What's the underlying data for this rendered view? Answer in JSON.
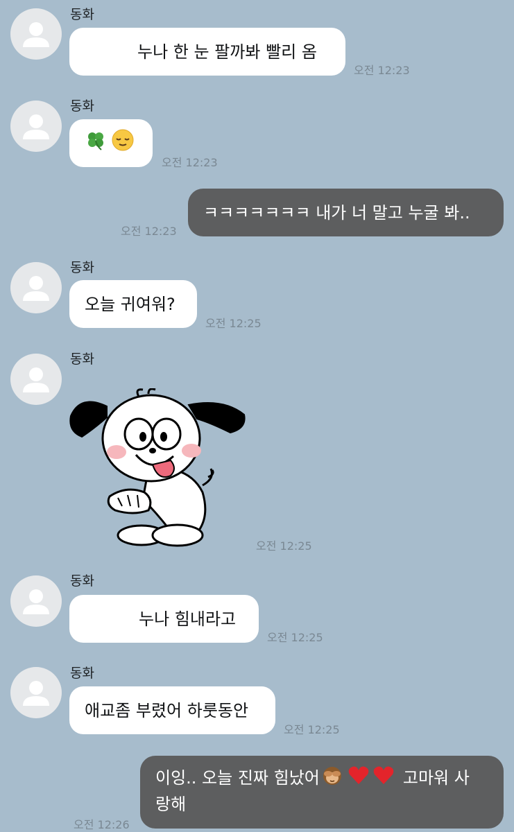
{
  "contact": {
    "name": "동화"
  },
  "colors": {
    "background": "#a7bccc",
    "incoming_bubble": "#ffffff",
    "outgoing_bubble": "#5d5e5f"
  },
  "messages": [
    {
      "sender": "동화",
      "direction": "incoming",
      "text": "누나 한 눈 팔까봐 빨리 옴",
      "time": "오전 12:23"
    },
    {
      "sender": "동화",
      "direction": "incoming",
      "text": "",
      "emojis": [
        "four-leaf-clover-icon",
        "relieved-face-icon"
      ],
      "time": "오전 12:23"
    },
    {
      "sender": "me",
      "direction": "outgoing",
      "text": "ㅋㅋㅋㅋㅋㅋㅋ 내가 너 말고 누굴 봐..",
      "time": "오전 12:23"
    },
    {
      "sender": "동화",
      "direction": "incoming",
      "text": "오늘 귀여워?",
      "time": "오전 12:25"
    },
    {
      "sender": "동화",
      "direction": "incoming",
      "sticker": "dog-sticker",
      "time": "오전 12:25"
    },
    {
      "sender": "동화",
      "direction": "incoming",
      "text": "누나 힘내라고",
      "time": "오전 12:25"
    },
    {
      "sender": "동화",
      "direction": "incoming",
      "text": "애교좀 부렸어 하룻동안",
      "time": "오전 12:25"
    },
    {
      "sender": "me",
      "direction": "outgoing",
      "text_line1": "이잉.. 오늘 진짜 힘났어",
      "text_line1_tail": "고마워 사",
      "text_line2": "랑해",
      "emojis": [
        "see-no-evil-monkey-icon",
        "red-heart-icon",
        "red-heart-icon"
      ],
      "time": "오전 12:26"
    }
  ]
}
